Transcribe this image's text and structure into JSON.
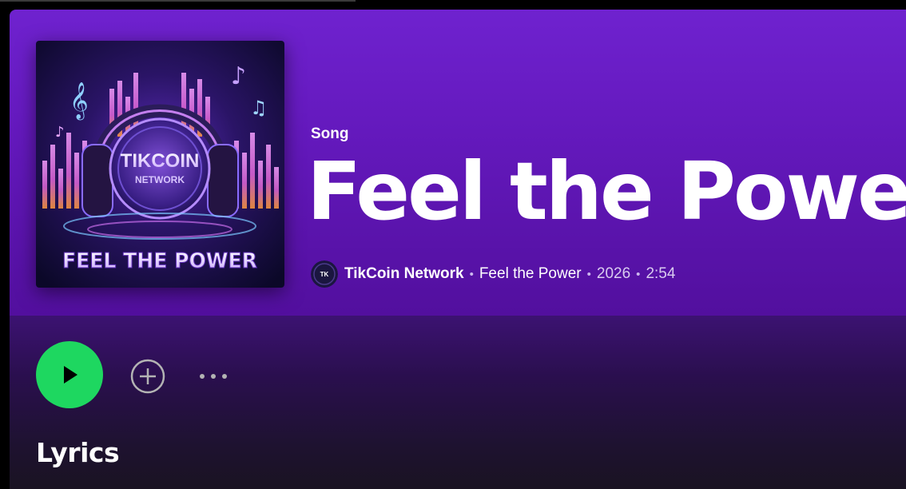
{
  "song": {
    "type_label": "Song",
    "title": "Feel the Power",
    "cover_text_logo": "TIKCOIN",
    "cover_text_sub": "NETWORK",
    "cover_text_title": "FEEL THE POWER"
  },
  "meta": {
    "artist": "TikCoin Network",
    "separator": "•",
    "album": "Feel the Power",
    "year": "2026",
    "duration": "2:54"
  },
  "actions": {
    "play_icon": "play-icon",
    "add_icon": "add-circle-icon",
    "more_icon": "more-options-icon"
  },
  "sections": {
    "lyrics_heading": "Lyrics"
  },
  "colors": {
    "accent_green": "#1ed760",
    "hero_purple": "#6f22cf"
  }
}
